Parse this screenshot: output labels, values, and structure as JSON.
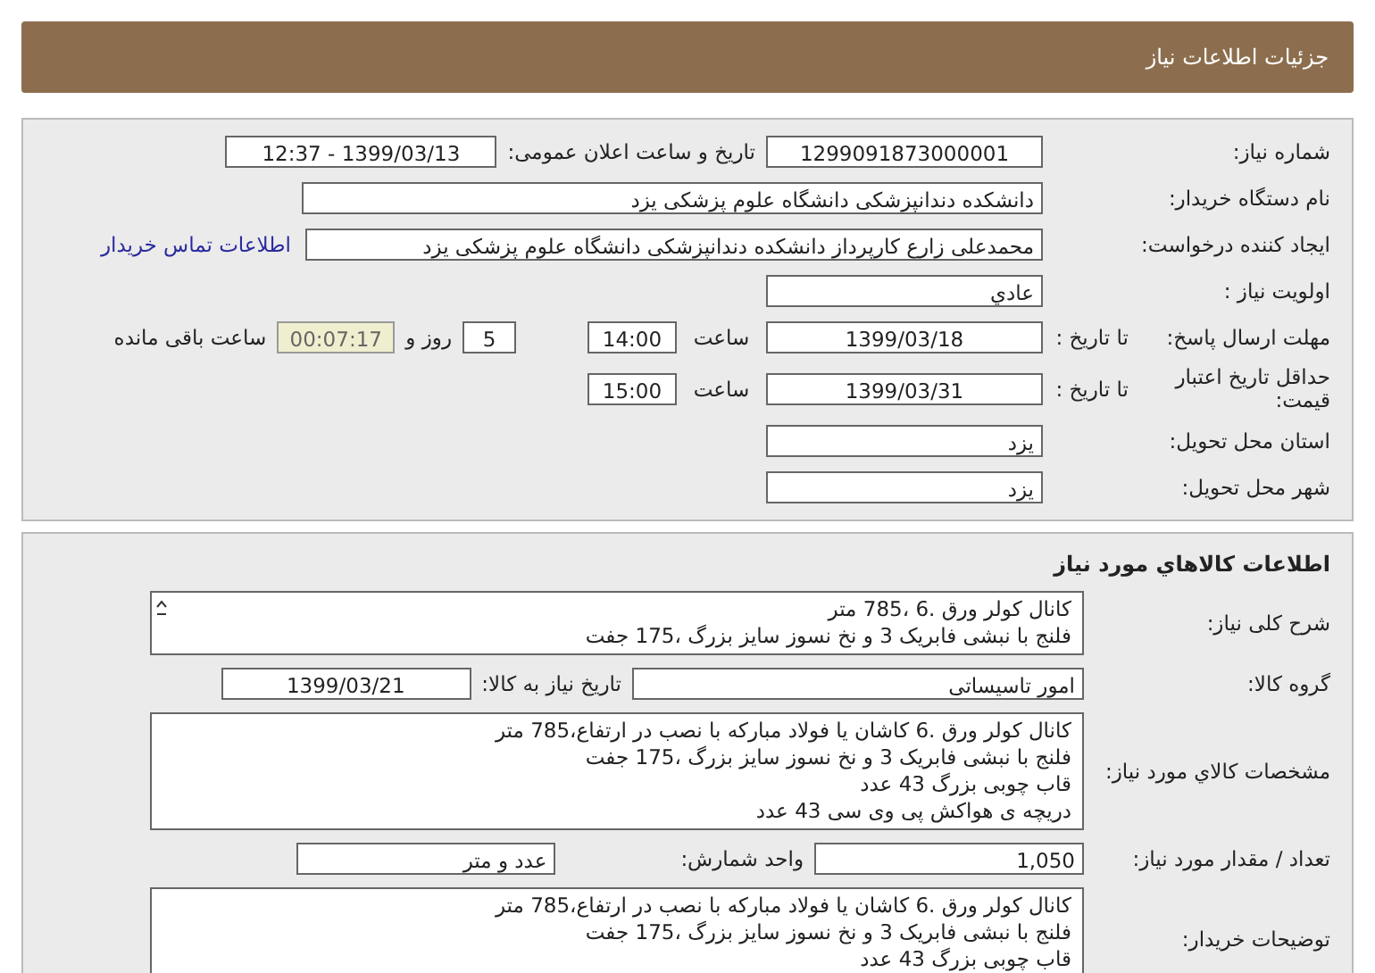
{
  "header": {
    "title": "جزئیات اطلاعات نیاز"
  },
  "details": {
    "need_number": {
      "label": "شماره نیاز:",
      "value": "1299091873000001"
    },
    "announce": {
      "label": "تاریخ و ساعت اعلان عمومی:",
      "value": "1399/03/13 - 12:37"
    },
    "buyer_org": {
      "label": "نام دستگاه خریدار:",
      "value": "دانشکده دندانپزشکی دانشگاه علوم پزشکی یزد"
    },
    "requester": {
      "label": "ایجاد کننده درخواست:",
      "value": "محمدعلی زارع کارپرداز دانشکده دندانپزشکی دانشگاه علوم پزشکی یزد"
    },
    "contact_link": "اطلاعات تماس خریدار",
    "priority": {
      "label": "اولویت نیاز :",
      "value": "عادي"
    },
    "response_deadline": {
      "label": "مهلت ارسال پاسخ:",
      "to_label": "تا تاریخ :",
      "date": "1399/03/18",
      "time_label": "ساعت",
      "time": "14:00",
      "days": "5",
      "days_label": "روز و",
      "remaining": "00:07:17",
      "remaining_label": "ساعت باقی مانده"
    },
    "price_validity": {
      "label": "حداقل تاریخ اعتبار قیمت:",
      "to_label": "تا تاریخ :",
      "date": "1399/03/31",
      "time_label": "ساعت",
      "time": "15:00"
    },
    "province": {
      "label": "استان محل تحویل:",
      "value": "یزد"
    },
    "city": {
      "label": "شهر محل تحویل:",
      "value": "یزد"
    }
  },
  "goods": {
    "title": "اطلاعات کالاهاي مورد نياز",
    "summary": {
      "label": "شرح کلی نیاز:",
      "lines": [
        "کانال کولر ورق .6 ،785 متر",
        "فلنج با نبشی فابریک 3 و نخ نسوز سایز بزرگ ،175 جفت"
      ]
    },
    "group": {
      "label": "گروه کالا:",
      "value": "امور تاسیساتی"
    },
    "need_date": {
      "label": "تاریخ نیاز به کالا:",
      "value": "1399/03/21"
    },
    "specs": {
      "label": "مشخصات کالاي مورد نياز:",
      "lines": [
        "کانال کولر ورق .6 کاشان یا فولاد مبارکه با نصب در ارتفاع،785 متر",
        "فلنج با نبشی فابریک 3 و نخ نسوز سایز بزرگ ،175 جفت",
        "قاب چوبی بزرگ 43 عدد",
        "دریچه ی هواکش پی  وی سی 43 عدد"
      ]
    },
    "quantity": {
      "label": "تعداد / مقدار مورد نیاز:",
      "value": "1,050"
    },
    "unit": {
      "label": "واحد شمارش:",
      "value": "عدد و متر"
    },
    "notes": {
      "label": "توضیحات خریدار:",
      "lines": [
        "کانال کولر ورق .6 کاشان یا فولاد مبارکه با نصب در ارتفاع،785 متر",
        "فلنج با نبشی فابریک 3 و نخ نسوز سایز بزرگ ،175 جفت",
        "قاب چوبی بزرگ 43 عدد"
      ]
    }
  }
}
